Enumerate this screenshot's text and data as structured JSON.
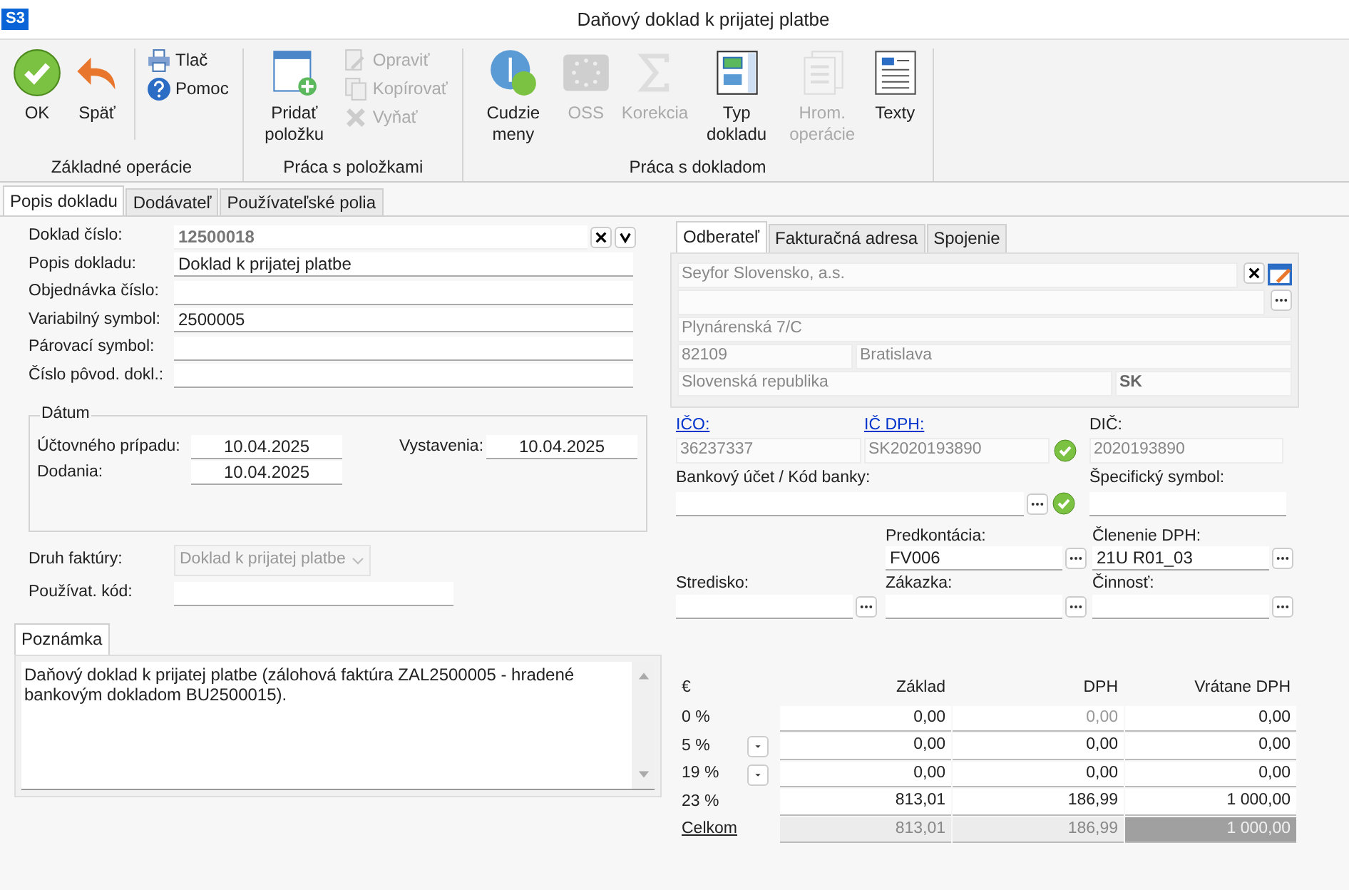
{
  "window": {
    "logo": "S3",
    "title": "Daňový doklad k prijatej platbe"
  },
  "ribbon": {
    "groups": [
      {
        "label": "Základné operácie",
        "buttons": [
          {
            "label": "OK",
            "kind": "large",
            "disabled": false
          },
          {
            "label": "Späť",
            "kind": "large",
            "disabled": false
          },
          {
            "label": "Tlač",
            "kind": "small",
            "disabled": false
          },
          {
            "label": "Pomoc",
            "kind": "small",
            "disabled": false
          }
        ]
      },
      {
        "label": "Práca s položkami",
        "buttons": [
          {
            "label": "Pridať položku",
            "kind": "large",
            "disabled": false
          },
          {
            "label": "Opraviť",
            "kind": "small",
            "disabled": true
          },
          {
            "label": "Kopírovať",
            "kind": "small",
            "disabled": true
          },
          {
            "label": "Vyňať",
            "kind": "small",
            "disabled": true
          }
        ]
      },
      {
        "label": "Práca s dokladom",
        "buttons": [
          {
            "label": "Cudzie meny",
            "kind": "large",
            "disabled": false
          },
          {
            "label": "OSS",
            "kind": "large",
            "disabled": true
          },
          {
            "label": "Korekcia",
            "kind": "large",
            "disabled": true
          },
          {
            "label": "Typ dokladu",
            "kind": "large",
            "disabled": false
          },
          {
            "label": "Hrom. operácie",
            "kind": "large",
            "disabled": true
          },
          {
            "label": "Texty",
            "kind": "large",
            "disabled": false
          }
        ]
      }
    ]
  },
  "doc_tabs": [
    {
      "label": "Popis dokladu",
      "selected": true
    },
    {
      "label": "Dodávateľ",
      "selected": false
    },
    {
      "label": "Používateľské polia",
      "selected": false
    }
  ],
  "fields": [
    {
      "label": "Doklad číslo:",
      "value": "12500018",
      "kind": "number"
    },
    {
      "label": "Popis dokladu:",
      "value": "Doklad k prijatej platbe",
      "kind": "text"
    },
    {
      "label": "Objednávka číslo:",
      "kind": "text"
    },
    {
      "label": "Variabilný symbol:",
      "value": "2500005",
      "kind": "text"
    },
    {
      "label": "Párovací symbol:",
      "kind": "text"
    },
    {
      "label": "Číslo pôvod. dokl.:",
      "kind": "text"
    }
  ],
  "dates": {
    "legend": "Dátum",
    "items": [
      {
        "label": "Účtovného prípadu:",
        "value": "10.04.2025"
      },
      {
        "label": "Vystavenia:",
        "value": "10.04.2025"
      },
      {
        "label": "Dodania:",
        "value": "10.04.2025"
      }
    ]
  },
  "invoice_type": {
    "label": "Druh faktúry:",
    "value": "Doklad k prijatej platbe",
    "disabled": true
  },
  "user_code": {
    "label": "Používat. kód:"
  },
  "note": {
    "tab": "Poznámka",
    "text": "Daňový doklad k prijatej platbe (zálohová faktúra ZAL2500005 - hradené bankovým dokladom BU2500015)."
  },
  "partner_tabs": [
    {
      "label": "Odberateľ",
      "selected": true
    },
    {
      "label": "Fakturačná adresa",
      "selected": false
    },
    {
      "label": "Spojenie",
      "selected": false
    }
  ],
  "partner": {
    "name": "Seyfor Slovensko, a.s.",
    "street": "Plynárenská 7/C",
    "zip": "82109",
    "city": "Bratislava",
    "country": "Slovenská republika",
    "country_code": "SK"
  },
  "ids": [
    {
      "label": "IČO:",
      "value": "36237337",
      "link": true,
      "verified": false
    },
    {
      "label": "IČ DPH:",
      "value": "SK2020193890",
      "link": true,
      "verified": true
    },
    {
      "label": "DIČ:",
      "value": "2020193890",
      "link": false,
      "verified": false
    }
  ],
  "bank": {
    "label": "Bankový účet / Kód banky:",
    "verified": true
  },
  "specific_symbol": {
    "label": "Špecifický symbol:"
  },
  "codes": [
    {
      "label": "Predkontácia:",
      "value": "FV006"
    },
    {
      "label": "Členenie DPH:",
      "value": "21U R01_03"
    },
    {
      "label": "Stredisko:"
    },
    {
      "label": "Zákazka:"
    },
    {
      "label": "Činnosť:"
    }
  ],
  "vat": {
    "currency": "€",
    "columns": [
      "Základ",
      "DPH",
      "Vrátane DPH"
    ],
    "rows": [
      {
        "rate": "0 %",
        "kind": "normal",
        "has_menu": false,
        "cells": [
          {
            "text": "0,00",
            "readonly": false
          },
          {
            "text": "0,00",
            "readonly": true
          },
          {
            "text": "0,00",
            "readonly": false
          }
        ]
      },
      {
        "rate": "5 %",
        "kind": "normal",
        "has_menu": true,
        "cells": [
          {
            "text": "0,00",
            "readonly": false
          },
          {
            "text": "0,00",
            "readonly": false
          },
          {
            "text": "0,00",
            "readonly": false
          }
        ]
      },
      {
        "rate": "19 %",
        "kind": "normal",
        "has_menu": true,
        "cells": [
          {
            "text": "0,00",
            "readonly": false
          },
          {
            "text": "0,00",
            "readonly": false
          },
          {
            "text": "0,00",
            "readonly": false
          }
        ]
      },
      {
        "rate": "23 %",
        "kind": "normal",
        "has_menu": false,
        "cells": [
          {
            "text": "813,01",
            "readonly": false
          },
          {
            "text": "186,99",
            "readonly": false
          },
          {
            "text": "1 000,00",
            "readonly": false
          }
        ]
      },
      {
        "rate": "Celkom",
        "kind": "total",
        "has_menu": false,
        "cells": [
          {
            "text": "813,01",
            "readonly": true
          },
          {
            "text": "186,99",
            "readonly": true
          },
          {
            "text": "1 000,00",
            "readonly": true
          }
        ]
      }
    ]
  }
}
